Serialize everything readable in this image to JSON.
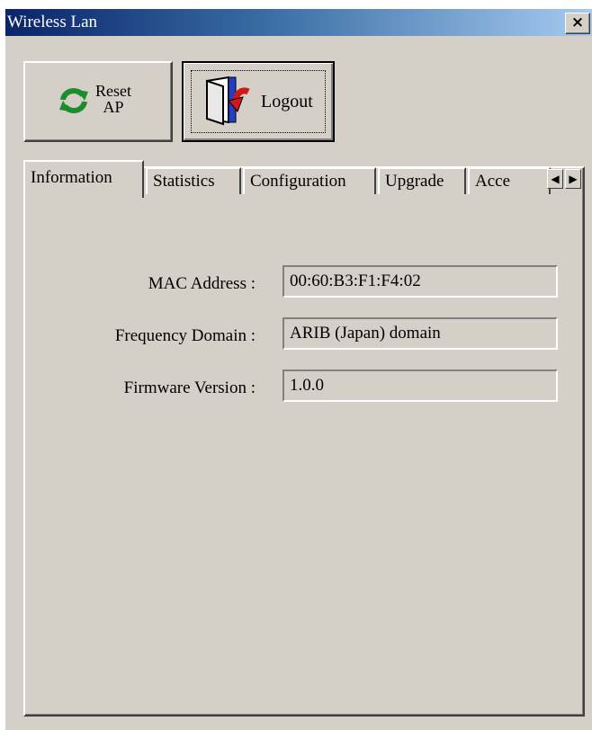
{
  "window": {
    "title": "Wireless Lan",
    "close_symbol": "×"
  },
  "toolbar": {
    "reset_label_line1": "Reset",
    "reset_label_line2": "AP",
    "reset_icon": "refresh-icon",
    "logout_label": "Logout",
    "logout_icon": "door-exit-icon"
  },
  "tabs": [
    {
      "label": "Information",
      "active": true
    },
    {
      "label": "Statistics",
      "active": false
    },
    {
      "label": "Configuration",
      "active": false
    },
    {
      "label": "Upgrade",
      "active": false
    },
    {
      "label": "Acce",
      "active": false
    }
  ],
  "tab_scroll": {
    "left": "◀",
    "right": "▶"
  },
  "info": {
    "mac_label": "MAC Address :",
    "mac_value": "00:60:B3:F1:F4:02",
    "freq_label": "Frequency Domain :",
    "freq_value": "ARIB (Japan) domain",
    "fw_label": "Firmware Version :",
    "fw_value": "1.0.0"
  },
  "colors": {
    "titlebar_start": "#0a246a",
    "titlebar_end": "#a6caf0",
    "face": "#d4d0c8",
    "refresh_green": "#1c8c2c",
    "logout_red": "#d01818"
  }
}
